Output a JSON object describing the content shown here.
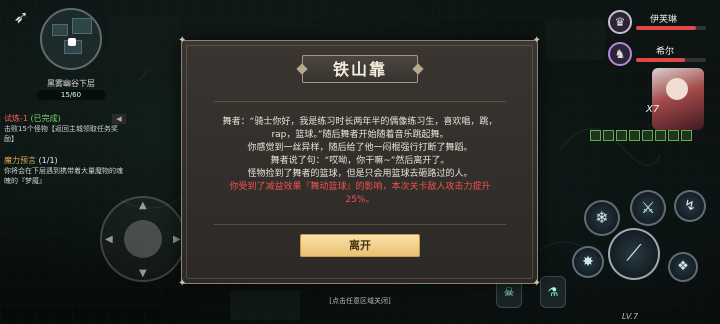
{
  "hud": {
    "back_icon": "winged-boot-icon",
    "area_name": "黑雾幽谷下层",
    "area_progress": "15/60",
    "quests": [
      {
        "title": "试炼-1",
        "status": "(已完成)",
        "desc": "击败15个怪物【返回主城领取任务奖励】",
        "color": "#ff5a5a"
      },
      {
        "title": "魔力预言",
        "count": "(1/1)",
        "desc": "你将会在下层遇到携带着大量魔物的魂魄的『梦魇』",
        "color": "#e2a64f"
      }
    ],
    "quest_toggle": "◀"
  },
  "party": [
    {
      "name": "伊芙琳",
      "hp": 0.85
    },
    {
      "name": "希尔",
      "hp": 0.7
    }
  ],
  "hero": {
    "multiplier": "X7"
  },
  "dialog": {
    "title": "铁山靠",
    "paragraphs": [
      "舞者：“骑士你好，我是练习时长两年半的偶像练习生，喜欢唱，跳，rap，篮球。”随后舞者开始随着音乐跳起舞。",
      "你感觉到一丝异样，随后给了他一闷棍强行打断了舞蹈。",
      "舞者说了句：“哎呦，你干嘛~”然后离开了。",
      "怪物捡到了舞者的篮球，但是只会用篮球去砸路过的人。"
    ],
    "effect_text": "你受到了减益效果『舞动篮球』的影响，本次关卡敌人攻击力提升25%。",
    "effect_color": "#f05252",
    "leave_button": "离开"
  },
  "bottom_hint": "[点击任意区域关闭]",
  "level_label": "LV.7"
}
